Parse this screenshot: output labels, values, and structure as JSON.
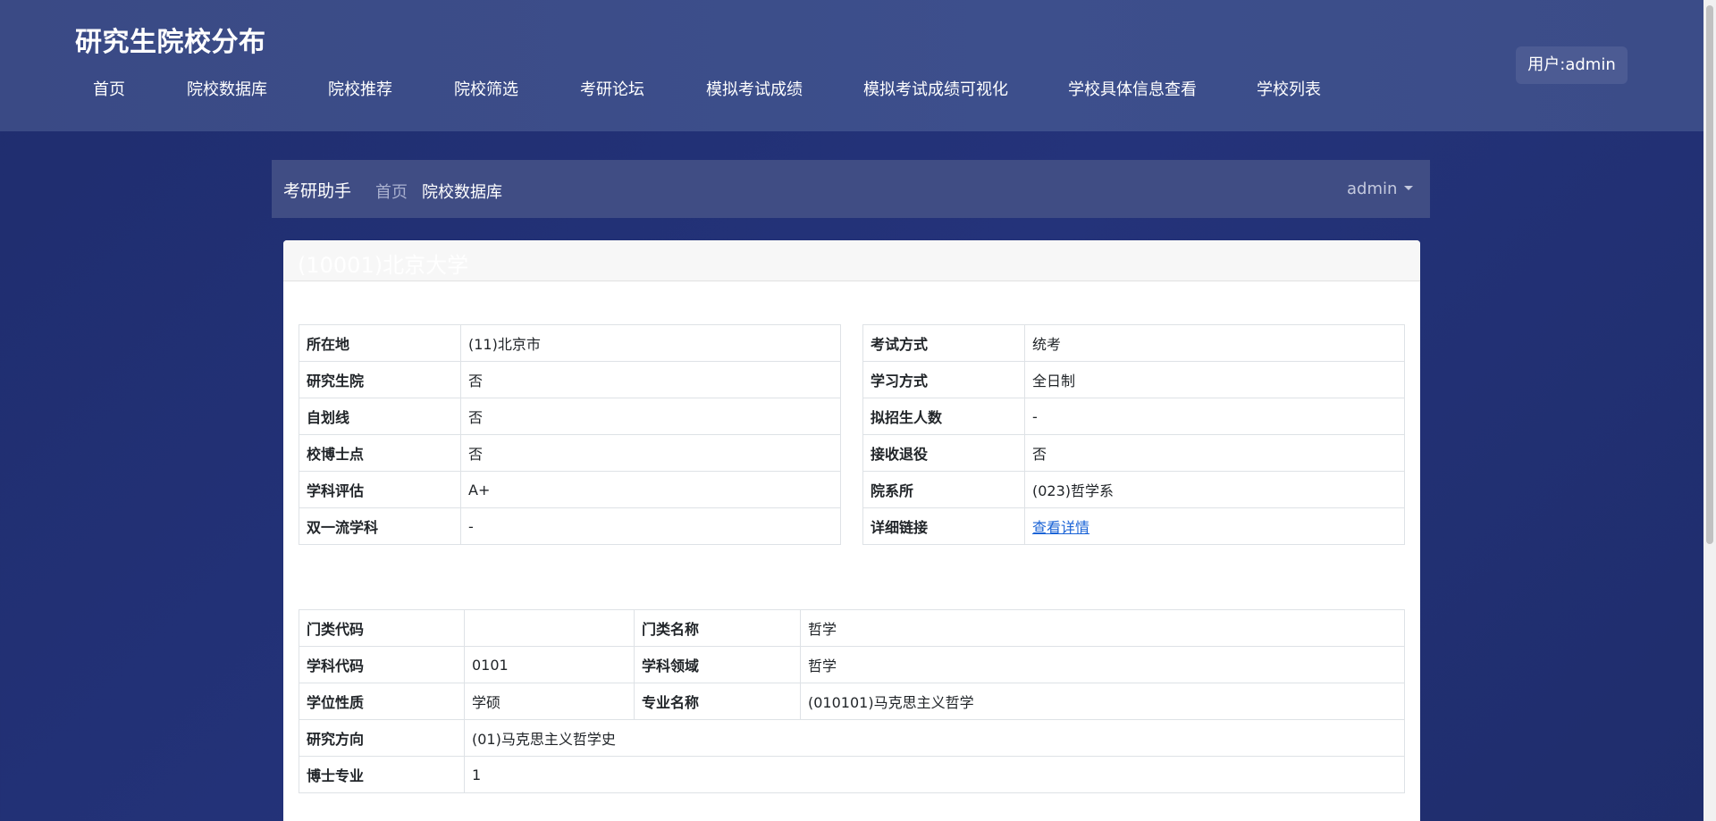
{
  "header": {
    "site_title": "研究生院校分布",
    "nav": [
      "首页",
      "院校数据库",
      "院校推荐",
      "院校筛选",
      "考研论坛",
      "模拟考试成绩",
      "模拟考试成绩可视化",
      "学校具体信息查看",
      "学校列表"
    ],
    "user_label": "用户:admin"
  },
  "breadcrumb": {
    "brand": "考研助手",
    "home": "首页",
    "current": "院校数据库",
    "account": "admin"
  },
  "school": {
    "title": "(10001)北京大学",
    "left_table": [
      {
        "label": "所在地",
        "value": "(11)北京市"
      },
      {
        "label": "研究生院",
        "value": "否"
      },
      {
        "label": "自划线",
        "value": "否"
      },
      {
        "label": "校博士点",
        "value": "否"
      },
      {
        "label": "学科评估",
        "value": "A+"
      },
      {
        "label": "双一流学科",
        "value": "-"
      }
    ],
    "right_table": [
      {
        "label": "考试方式",
        "value": "统考"
      },
      {
        "label": "学习方式",
        "value": "全日制"
      },
      {
        "label": "拟招生人数",
        "value": "-"
      },
      {
        "label": "接收退役",
        "value": "否"
      },
      {
        "label": "院系所",
        "value": "(023)哲学系"
      },
      {
        "label": "详细链接",
        "value": "查看详情"
      }
    ],
    "detail": {
      "category_code_label": "门类代码",
      "category_code": "",
      "category_name_label": "门类名称",
      "category_name": "哲学",
      "subject_code_label": "学科代码",
      "subject_code": "0101",
      "subject_field_label": "学科领域",
      "subject_field": "哲学",
      "degree_type_label": "学位性质",
      "degree_type": "学硕",
      "major_name_label": "专业名称",
      "major_name": "(010101)马克思主义哲学",
      "research_label": "研究方向",
      "research": "(01)马克思主义哲学史",
      "phd_label": "博士专业",
      "phd": "1"
    }
  },
  "colors": {
    "background": "#22307a",
    "topbar": "#3b4c88",
    "breadcrumb_bar": "#404d84",
    "link": "#1a63d6"
  }
}
